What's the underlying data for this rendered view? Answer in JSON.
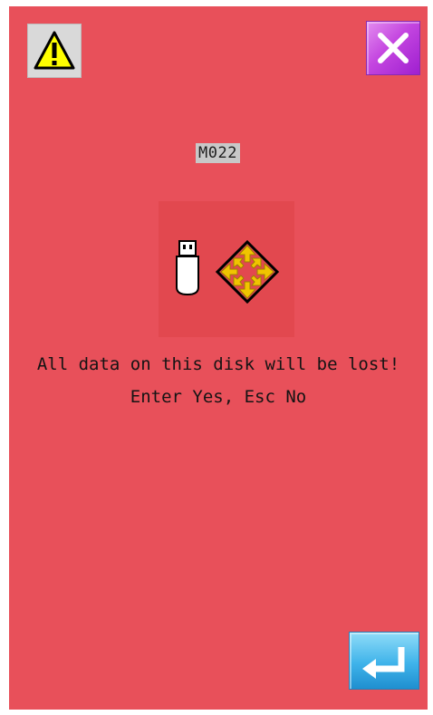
{
  "message": {
    "code": "M022",
    "line1": "All data on this disk will be lost!",
    "line2": "Enter Yes, Esc No"
  },
  "icons": {
    "warning": "warning-icon",
    "close": "close-icon",
    "usb": "usb-drive-icon",
    "move": "move-arrows-icon",
    "enter": "enter-icon"
  },
  "colors": {
    "background": "#e8505a",
    "close_button": "#c446e0",
    "enter_button": "#3fb3ea",
    "warning": "#ffff00"
  }
}
